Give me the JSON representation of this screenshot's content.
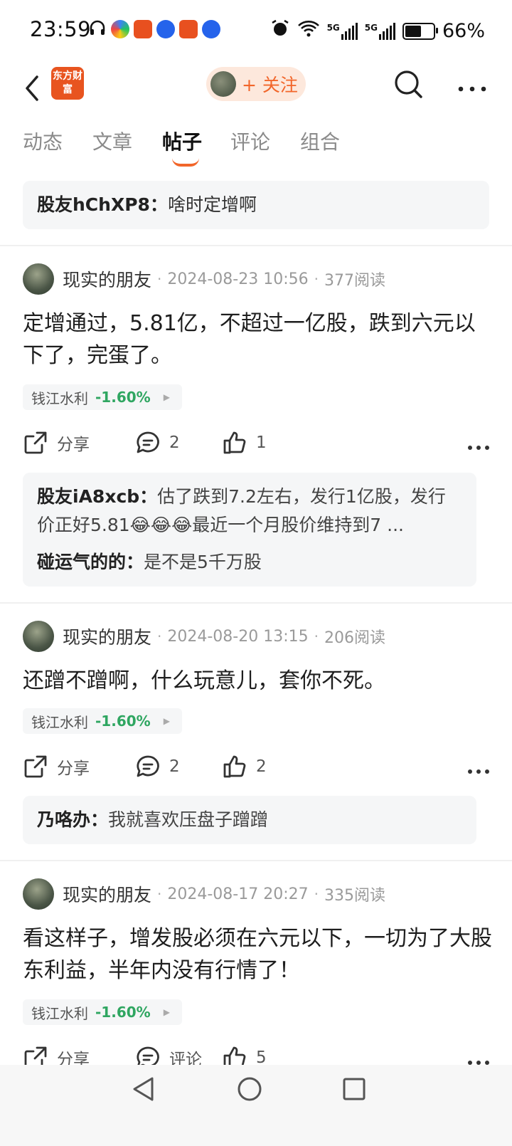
{
  "status_bar": {
    "time": "23:59",
    "network": [
      "5G",
      "5G"
    ],
    "battery": "66%",
    "battery_level": 0.66
  },
  "header": {
    "logo_text": "东方财富",
    "follow_label": "+ 关注"
  },
  "tabs": [
    "动态",
    "文章",
    "帖子",
    "评论",
    "组合"
  ],
  "active_tab": "帖子",
  "top_comment": {
    "user": "股友hChXP8：",
    "text": "啥时定增啊"
  },
  "posts": [
    {
      "author": "现实的朋友",
      "time": "2024-08-23 10:56",
      "views": "377阅读",
      "text": "定增通过，5.81亿，不超过一亿股，跌到六元以下了，完蛋了。",
      "stock": {
        "name": "钱江水利",
        "change": "-1.60%"
      },
      "share_label": "分享",
      "comments": "2",
      "likes": "1",
      "replies": [
        {
          "user": "股友iA8xcb：",
          "text": "估了跌到7.2左右，发行1亿股，发行价正好5.81😂😂😂最近一个月股价维持到7 ..."
        },
        {
          "user": "碰运气的的：",
          "text": "是不是5千万股"
        }
      ]
    },
    {
      "author": "现实的朋友",
      "time": "2024-08-20 13:15",
      "views": "206阅读",
      "text": "还蹭不蹭啊，什么玩意儿，套你不死。",
      "stock": {
        "name": "钱江水利",
        "change": "-1.60%"
      },
      "share_label": "分享",
      "comments": "2",
      "likes": "2",
      "replies": [
        {
          "user": "乃咯办：",
          "text": "我就喜欢压盘子蹭蹭"
        }
      ]
    },
    {
      "author": "现实的朋友",
      "time": "2024-08-17 20:27",
      "views": "335阅读",
      "text": "看这样子，增发股必须在六元以下，一切为了大股东利益，半年内没有行情了！",
      "stock": {
        "name": "钱江水利",
        "change": "-1.60%"
      },
      "share_label": "分享",
      "comments": "评论",
      "likes": "5",
      "replies": []
    }
  ],
  "colors": {
    "accent": "#f2662a",
    "stock_down": "#2fa661",
    "card_bg": "#f5f6f7"
  }
}
